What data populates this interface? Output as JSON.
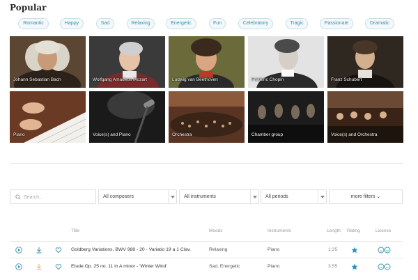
{
  "page": {
    "title": "Popular"
  },
  "moods": [
    "Romantic",
    "Happy",
    "Sad",
    "Relaxing",
    "Energetic",
    "Fun",
    "Celebratory",
    "Tragic",
    "Passionate",
    "Dramatic"
  ],
  "composers": [
    {
      "name": "Johann Sebastian Bach",
      "image": "portrait-of-bach"
    },
    {
      "name": "Wolfgang Amadeus Mozart",
      "image": "portrait-of-mozart"
    },
    {
      "name": "Ludwig van Beethoven",
      "image": "portrait-of-beethoven"
    },
    {
      "name": "Frédéric Chopin",
      "image": "portrait-of-chopin"
    },
    {
      "name": "Franz Schubert",
      "image": "portrait-of-schubert"
    }
  ],
  "instruments": [
    {
      "name": "Piano",
      "image": "hands-on-piano-keys"
    },
    {
      "name": "Voice(s) and Piano",
      "image": "microphone-on-stage"
    },
    {
      "name": "Orchestra",
      "image": "orchestra-in-concert-hall"
    },
    {
      "name": "Chamber group",
      "image": "chamber-group-on-stage"
    },
    {
      "name": "Voice(s) and Orchestra",
      "image": "singers-with-orchestra"
    }
  ],
  "filters": {
    "search_placeholder": "Search...",
    "composers": "All composers",
    "instruments": "All instruments",
    "periods": "All periods",
    "more": "more filters ⌄"
  },
  "table": {
    "headers": {
      "title": "Title",
      "moods": "Moods",
      "instruments": "Instruments",
      "length": "Length",
      "rating": "Rating",
      "license": "License"
    },
    "rows": [
      {
        "title": "Goldberg Variations, BWV 988 - 20 - Variatio 19 a 1 Clav.",
        "moods": "Relaxing",
        "instruments": "Piano",
        "length": "1:25"
      },
      {
        "title": "Etude Op. 25 no. 11 in A minor - 'Winter Wind'",
        "moods": "Sad, Energetic",
        "instruments": "Piano",
        "length": "3:55"
      }
    ]
  },
  "colors": {
    "accent": "#3a8cad",
    "download_highlight": "#e6b84a",
    "rating_star": "#2b8fb8"
  }
}
